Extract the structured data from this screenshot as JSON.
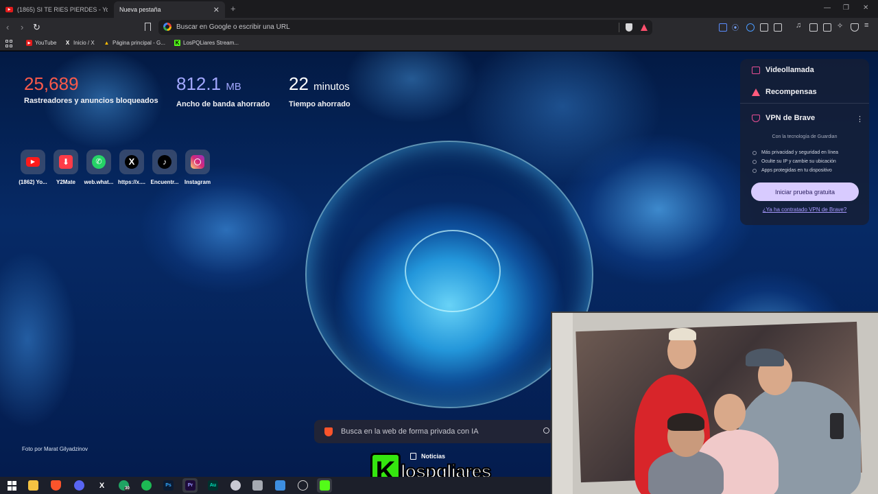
{
  "browser": {
    "tabs": [
      {
        "title": "(1865) SI TE RIES PIERDES - YouTube",
        "active": false
      },
      {
        "title": "Nueva pestaña",
        "active": true
      }
    ],
    "new_tab_symbol": "+",
    "address_bar": {
      "placeholder": "Buscar en Google o escribir una URL"
    },
    "bookmarks": [
      {
        "label": "YouTube",
        "icon": "youtube-icon"
      },
      {
        "label": "Inicio / X",
        "icon": "x-icon"
      },
      {
        "label": "Página principal - G...",
        "icon": "drive-icon"
      },
      {
        "label": "LosPQLiares Stream...",
        "icon": "kick-icon"
      }
    ]
  },
  "stats": [
    {
      "value": "25,689",
      "unit": "",
      "label": "Rastreadores y anuncios bloqueados",
      "color": "#fb5a4a"
    },
    {
      "value": "812.1",
      "unit": "MB",
      "label": "Ancho de banda ahorrado",
      "color": "#a3a8ff"
    },
    {
      "value": "22",
      "unit": "minutos",
      "label": "Tiempo ahorrado",
      "color": "#ffffff"
    }
  ],
  "top_sites": [
    {
      "label": "(1862) Yo...",
      "icon": "youtube-icon"
    },
    {
      "label": "Y2Mate",
      "icon": "download-icon"
    },
    {
      "label": "web.what...",
      "icon": "whatsapp-icon"
    },
    {
      "label": "https://x....",
      "icon": "x-icon"
    },
    {
      "label": "Encuentr...",
      "icon": "tiktok-icon"
    },
    {
      "label": "Instagram",
      "icon": "instagram-icon"
    }
  ],
  "photo_credit": "Foto por Marat Gilyadzinov",
  "search": {
    "placeholder": "Busca en la web de forma privada con IA"
  },
  "widget": {
    "videocall": "Videollamada",
    "rewards": "Recompensas",
    "vpn_title": "VPN de Brave",
    "powered_by": "Con la tecnología de  Guardian",
    "features": [
      "Más privacidad y seguridad en línea",
      "Oculte su IP y cambie su ubicación",
      "Apps protegidas en tu dispositivo"
    ],
    "cta": "Iniciar prueba gratuita",
    "link": "¿Ya ha contratado VPN de Brave?"
  },
  "overlay": {
    "logo_k": "K",
    "logo_text": "lospqliares",
    "news_label": "Noticias"
  },
  "taskbar": {
    "badge_count": "30",
    "app_labels": {
      "photoshop": "Ps",
      "premiere": "Pr",
      "audition": "Au"
    }
  }
}
